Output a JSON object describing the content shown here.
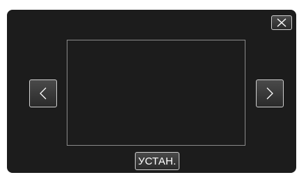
{
  "screen": {
    "set_button_label": "УСТАН.",
    "icons": {
      "close": "close-icon",
      "previous": "chevron-left-icon",
      "next": "chevron-right-icon"
    },
    "colors": {
      "background": "#1c1c1c",
      "button_border": "#cfcfcf",
      "frame_border": "#8a8a8a"
    }
  }
}
